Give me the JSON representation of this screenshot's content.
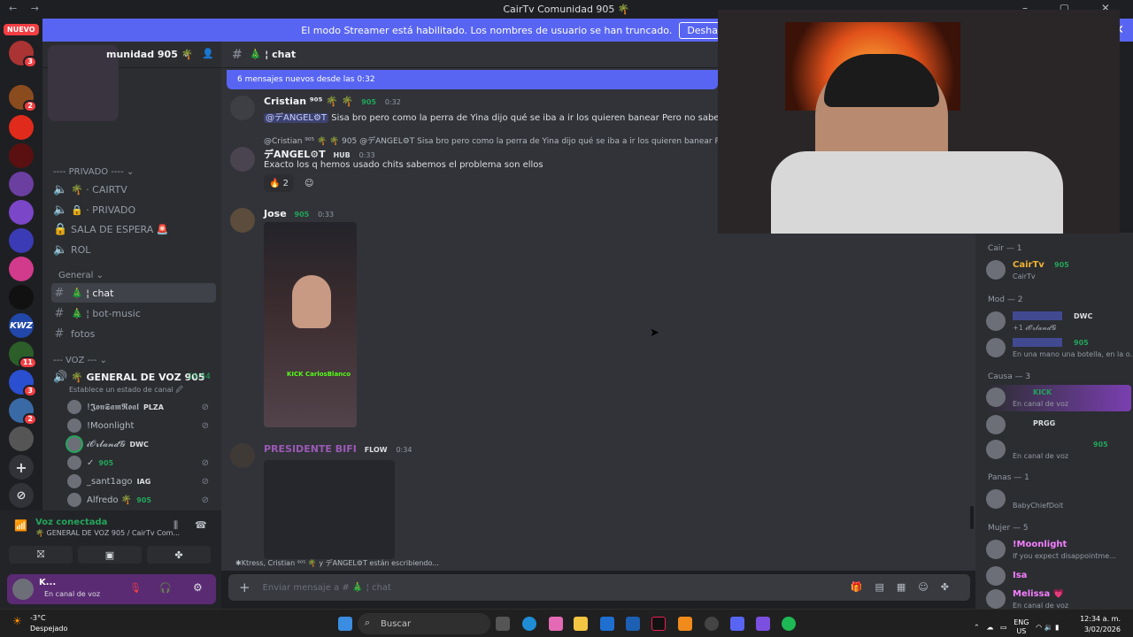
{
  "window": {
    "title": "CairTv Comunidad 905 🌴"
  },
  "banner": {
    "text": "El modo Streamer está habilitado. Los nombres de usuario se han truncado.",
    "button": "Desha"
  },
  "rail": {
    "new_badge": "NUEVO",
    "badges": [
      "3",
      "2",
      "11",
      "3",
      "2"
    ]
  },
  "server": {
    "name": "munidad 905 🌴",
    "private_category": "---- PRIVADO ---- ⌄",
    "voice_category": "--- VOZ --- ⌄",
    "general_category": "General ⌄",
    "channels": [
      {
        "name": "🌴 · CAIRTV"
      },
      {
        "name": "🔒 · PRIVADO"
      },
      {
        "name": "SALA DE ESPERA 🚨"
      },
      {
        "name": "ROL"
      },
      {
        "name": "🎄 ¦ chat"
      },
      {
        "name": "🎄 ¦ bot-music"
      },
      {
        "name": "fotos"
      }
    ],
    "voice_channel": {
      "name": "🌴 GENERAL DE VOZ 905",
      "timer": "10:54",
      "status": "Establece un estado de canal 🖉"
    },
    "voice_users": [
      {
        "name": "!𝕵𝖔𝖓𝕾𝖆𝖒𝕽𝖔𝖆𝖑",
        "tag": "PLZA"
      },
      {
        "name": "!Moonlight",
        "tag": ""
      },
      {
        "name": "𝓲𝓞𝓻𝓵𝓪𝓷𝓭𝓖",
        "tag": "DWC"
      },
      {
        "name": "✓",
        "tag": "905"
      },
      {
        "name": "_sant1ago",
        "tag": "IAG"
      },
      {
        "name": "Alfredo 🌴",
        "tag": "905"
      }
    ]
  },
  "voice_panel": {
    "status": "Voz conectada",
    "channel": "🌴 GENERAL DE VOZ 905 / CairTv Com...",
    "user_name": "K...",
    "user_status": "En canal de voz"
  },
  "chat": {
    "channel_header": "🎄 ¦ chat",
    "new_messages": "6 mensajes nuevos desde las 0:32",
    "messages": [
      {
        "author": "Cristian ⁹⁰⁵ 🌴 🌴",
        "tag": "905",
        "time": "0:32",
        "mention": "@デANGEL⚙T",
        "text": "Sisa bro pero como la perra de Yina dijo qué se iba a ir los quieren banear Pero no saben lo qué es t"
      },
      {
        "reply": "@Cristian ⁹⁰⁵ 🌴 🌴  905  @デANGEL⚙T  Sisa bro pero como la perra de Yina dijo qué se iba a ir los quieren banear Pero no s",
        "author": "デANGEL⚙T",
        "tag": "HUB",
        "time": "0:33",
        "text": "Exacto los q hemos usado chits sabemos el problema son ellos",
        "reaction_count": "2"
      },
      {
        "author": "Jose",
        "tag": "905",
        "time": "0:33",
        "image_caption": "KICK CarlosBlanco"
      },
      {
        "author": "PRESIDENTE BIFI",
        "tag": "FLOW",
        "time": "0:34"
      }
    ],
    "typing": "✱Ktress, Cristian ⁹⁰⁵ 🌴 y デANGEL⚙T están escribiendo...",
    "composer_placeholder": "Enviar mensaje a # 🎄 ¦ chat"
  },
  "members": {
    "groups": [
      {
        "title": "Cair — 1",
        "members": [
          {
            "name": "CairTv",
            "tag": "905",
            "sub": "CairTv",
            "color": "#f0b232"
          }
        ]
      },
      {
        "title": "Mod — 2",
        "members": [
          {
            "name": "",
            "tag": "DWC",
            "sub": "+1 𝓲𝓞𝓻𝓵𝓪𝓷𝓭𝓖",
            "color": "#5865f2"
          },
          {
            "name": "",
            "tag": "905",
            "sub": "En una mano una botella, en la o...",
            "color": "#5865f2"
          }
        ]
      },
      {
        "title": "Causa — 3",
        "members": [
          {
            "name": "",
            "tag": "KICK",
            "sub": "En canal de voz",
            "color": "#949ba4"
          },
          {
            "name": "",
            "tag": "PRGG",
            "sub": "",
            "color": "#949ba4"
          },
          {
            "name": "",
            "tag": "905",
            "sub": "En canal de voz",
            "color": "#949ba4"
          }
        ]
      },
      {
        "title": "Panas — 1",
        "members": [
          {
            "name": "",
            "tag": "",
            "sub": "BabyChiefDoit",
            "color": "#949ba4"
          }
        ]
      },
      {
        "title": "Mujer — 5",
        "members": [
          {
            "name": "!Moonlight",
            "tag": "",
            "sub": "If you expect disappointme...",
            "color": "#f47fff"
          },
          {
            "name": "Isa",
            "tag": "",
            "sub": "",
            "color": "#f47fff"
          },
          {
            "name": "Melissa 💗",
            "tag": "",
            "sub": "En canal de voz",
            "color": "#f47fff"
          }
        ]
      }
    ]
  },
  "taskbar": {
    "weather_temp": "-3°C",
    "weather_desc": "Despejado",
    "search": "Buscar",
    "lang": "ENG",
    "region": "US",
    "time": "12:34 a. m.",
    "date": "3/02/2026"
  },
  "colors": {
    "blurple": "#5865f2",
    "bg": "#313338",
    "sidebar": "#2b2d31",
    "green": "#23a55a",
    "red": "#f23f43"
  }
}
